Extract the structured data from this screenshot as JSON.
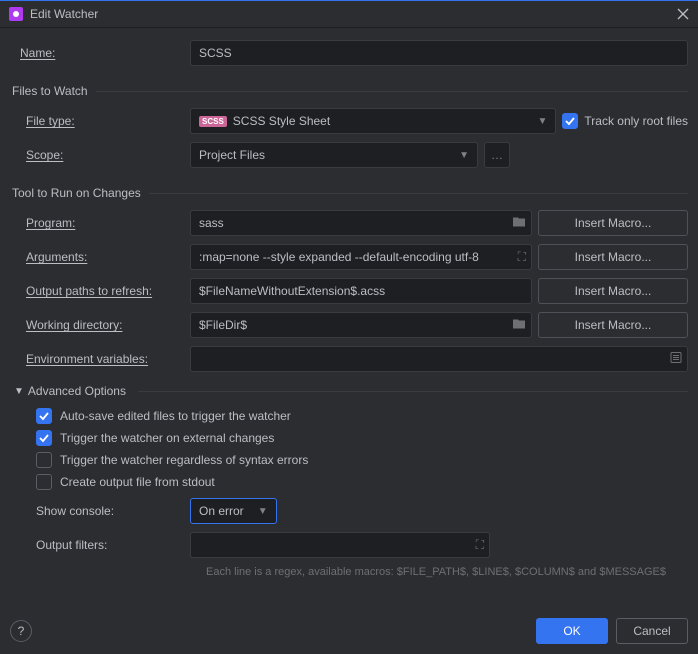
{
  "window": {
    "title": "Edit Watcher"
  },
  "name": {
    "label": "Name:",
    "value": "SCSS"
  },
  "filesToWatch": {
    "title": "Files to Watch",
    "fileType": {
      "label": "File type:",
      "value": "SCSS Style Sheet"
    },
    "trackRoot": {
      "label": "Track only root files",
      "checked": true
    },
    "scope": {
      "label": "Scope:",
      "value": "Project Files"
    }
  },
  "tool": {
    "title": "Tool to Run on Changes",
    "program": {
      "label": "Program:",
      "value": "sass"
    },
    "arguments": {
      "label": "Arguments:",
      "value": ":map=none --style expanded --default-encoding utf-8"
    },
    "outputPaths": {
      "label": "Output paths to refresh:",
      "value": "$FileNameWithoutExtension$.acss"
    },
    "workingDir": {
      "label": "Working directory:",
      "value": "$FileDir$"
    },
    "env": {
      "label": "Environment variables:",
      "value": ""
    },
    "macroBtn": "Insert Macro..."
  },
  "advanced": {
    "title": "Advanced Options",
    "autoSave": "Auto-save edited files to trigger the watcher",
    "externalChanges": "Trigger the watcher on external changes",
    "regardlessErrors": "Trigger the watcher regardless of syntax errors",
    "createOutput": "Create output file from stdout",
    "showConsole": {
      "label": "Show console:",
      "value": "On error"
    },
    "outputFilters": {
      "label": "Output filters:",
      "value": ""
    },
    "hint": "Each line is a regex, available macros: $FILE_PATH$, $LINE$, $COLUMN$ and $MESSAGE$"
  },
  "buttons": {
    "ok": "OK",
    "cancel": "Cancel"
  }
}
